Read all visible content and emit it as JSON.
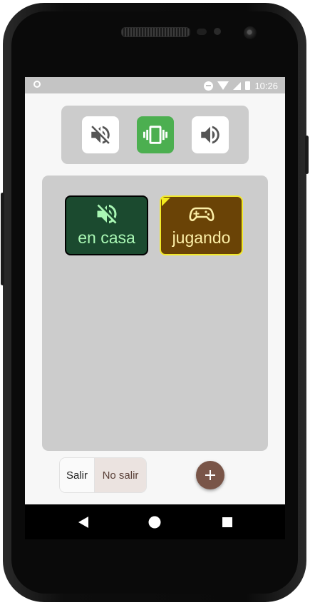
{
  "statusbar": {
    "time": "10:26"
  },
  "mode_selector": {
    "modes": [
      {
        "icon": "volume-off-icon",
        "active": false
      },
      {
        "icon": "vibrate-icon",
        "active": true
      },
      {
        "icon": "volume-up-icon",
        "active": false
      }
    ],
    "active_color": "#4caf50"
  },
  "cards": [
    {
      "label": "en casa",
      "icon": "volume-off-icon",
      "background": "#1b4a2f",
      "text_color": "#a9f7b4",
      "border": "#000000"
    },
    {
      "label": "jugando",
      "icon": "gamepad-icon",
      "background": "#6a4306",
      "text_color": "#fcefa8",
      "border": "#f1e82a",
      "selected": true
    }
  ],
  "exit_toggle": {
    "options": [
      "Salir",
      "No salir"
    ],
    "selected": "No salir"
  },
  "fab": {
    "icon": "plus-icon",
    "color": "#795548"
  },
  "navbar": {
    "buttons": [
      "back-icon",
      "home-icon",
      "recents-icon"
    ]
  }
}
